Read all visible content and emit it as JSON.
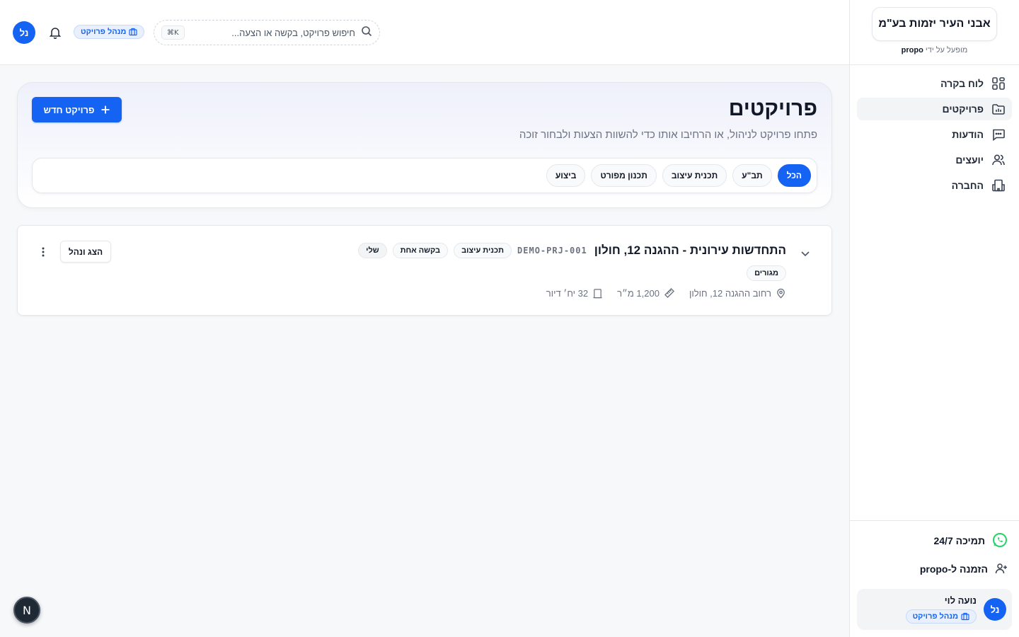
{
  "brand": {
    "company": "אבני העיר יזמות בע\"מ",
    "powered_prefix": "מופעל על ידי",
    "powered_name": "propo"
  },
  "sidebar": {
    "items": [
      {
        "label": "לוח בקרה",
        "icon": "dashboard-icon"
      },
      {
        "label": "פרויקטים",
        "icon": "folder-icon",
        "active": true
      },
      {
        "label": "הודעות",
        "icon": "message-icon"
      },
      {
        "label": "יועצים",
        "icon": "users-icon"
      },
      {
        "label": "החברה",
        "icon": "building-icon"
      }
    ],
    "support_label": "תמיכה 24/7",
    "invite_label": "הזמנה ל-propo",
    "user": {
      "initials": "נל",
      "name": "נועה לוי",
      "role": "מנהל פרויקט"
    }
  },
  "topbar": {
    "search_placeholder": "חיפוש פרויקט, בקשה או הצעה...",
    "shortcut": "⌘K",
    "role_badge": "מנהל פרויקט",
    "avatar_initials": "נל"
  },
  "header": {
    "title": "פרויקטים",
    "description": "פתחו פרויקט לניהול, או הרחיבו אותו כדי להשוות הצעות ולבחור זוכה",
    "new_button": "פרויקט חדש",
    "filters": [
      "הכל",
      "תב\"ע",
      "תכנית עיצוב",
      "תכנון מפורט",
      "ביצוע"
    ],
    "active_filter": "הכל"
  },
  "project": {
    "title": "התחדשות עירונית - ההגנה 12, חולון",
    "code": "DEMO-PRJ-001",
    "tags": [
      "תכנית עיצוב",
      "בקשה אחת",
      "שלי"
    ],
    "type_tag": "מגורים",
    "address": "רחוב ההגנה 12, חולון",
    "area": "1,200 מ״ר",
    "units": "32 יח׳ דיור",
    "view_button": "הצג ונהל"
  },
  "floating_button": "N",
  "colors": {
    "accent": "#1463f3",
    "whatsapp": "#25d366"
  }
}
